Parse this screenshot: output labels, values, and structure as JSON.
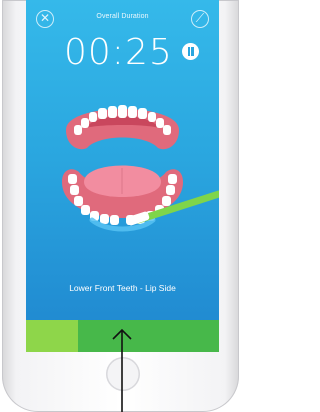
{
  "header": {
    "title": "Overall Duration",
    "close_icon": "close-icon",
    "brush_icon": "toothbrush-icon"
  },
  "timer": {
    "value": "00:25",
    "pause_icon": "pause-icon"
  },
  "zone": {
    "label": "Lower Front Teeth - Lip Side"
  },
  "progress": {
    "fraction": 0.27
  },
  "colors": {
    "screen_top": "#35b9ea",
    "screen_bottom": "#1f86cf",
    "progress_dark": "#47b84a",
    "progress_light": "#8ed64a",
    "gum": "#e06a7c",
    "tongue": "#f28da0",
    "brush": "#7fd54a"
  }
}
